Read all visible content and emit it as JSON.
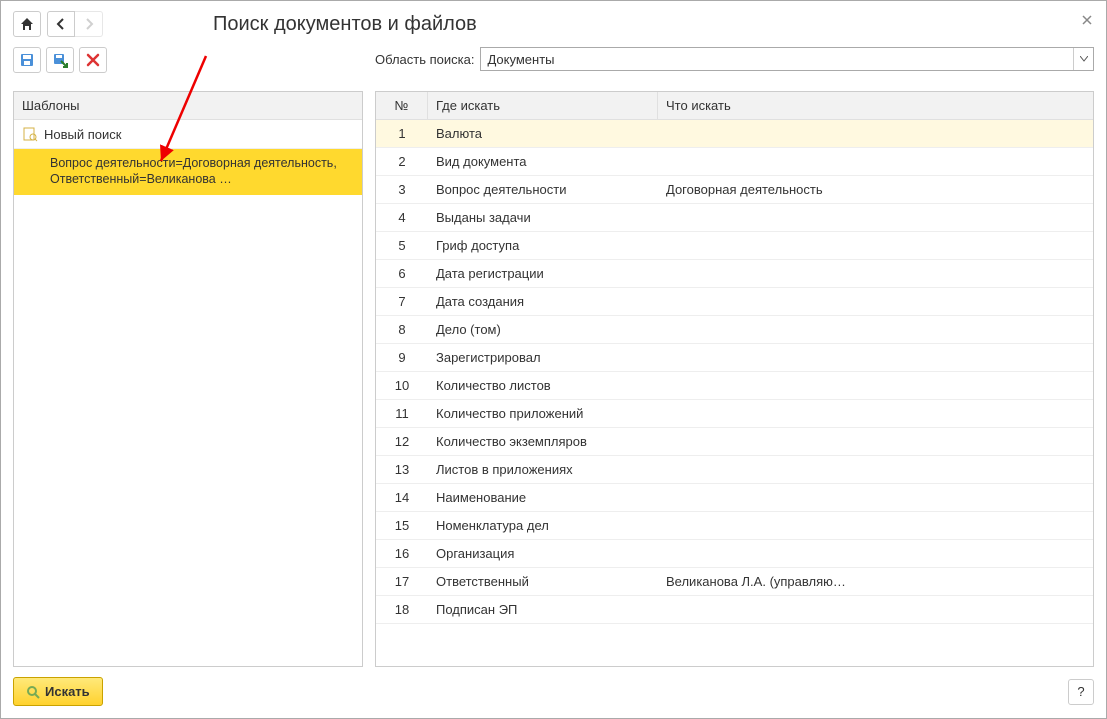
{
  "title": "Поиск документов и файлов",
  "scope": {
    "label": "Область поиска:",
    "value": "Документы"
  },
  "templates": {
    "header": "Шаблоны",
    "items": [
      {
        "label": "Новый поиск",
        "icon": "search-template",
        "selected": false,
        "indent": false
      },
      {
        "label": "Вопрос деятельности=Договорная деятельность, Ответственный=Великанова …",
        "icon": "",
        "selected": true,
        "indent": true
      }
    ]
  },
  "criteria": {
    "header": {
      "num": "№",
      "where": "Где искать",
      "what": "Что искать"
    },
    "rows": [
      {
        "num": 1,
        "where": "Валюта",
        "what": "",
        "active": true
      },
      {
        "num": 2,
        "where": "Вид документа",
        "what": ""
      },
      {
        "num": 3,
        "where": "Вопрос деятельности",
        "what": "Договорная деятельность"
      },
      {
        "num": 4,
        "where": "Выданы задачи",
        "what": ""
      },
      {
        "num": 5,
        "where": "Гриф доступа",
        "what": ""
      },
      {
        "num": 6,
        "where": "Дата регистрации",
        "what": ""
      },
      {
        "num": 7,
        "where": "Дата создания",
        "what": ""
      },
      {
        "num": 8,
        "where": "Дело (том)",
        "what": ""
      },
      {
        "num": 9,
        "where": "Зарегистрировал",
        "what": ""
      },
      {
        "num": 10,
        "where": "Количество листов",
        "what": ""
      },
      {
        "num": 11,
        "where": "Количество приложений",
        "what": ""
      },
      {
        "num": 12,
        "where": "Количество экземпляров",
        "what": ""
      },
      {
        "num": 13,
        "where": "Листов в приложениях",
        "what": ""
      },
      {
        "num": 14,
        "where": "Наименование",
        "what": ""
      },
      {
        "num": 15,
        "where": "Номенклатура дел",
        "what": ""
      },
      {
        "num": 16,
        "where": "Организация",
        "what": ""
      },
      {
        "num": 17,
        "where": "Ответственный",
        "what": "Великанова Л.А. (управляю…"
      },
      {
        "num": 18,
        "where": "Подписан ЭП",
        "what": ""
      }
    ]
  },
  "footer": {
    "search": "Искать",
    "help": "?"
  }
}
